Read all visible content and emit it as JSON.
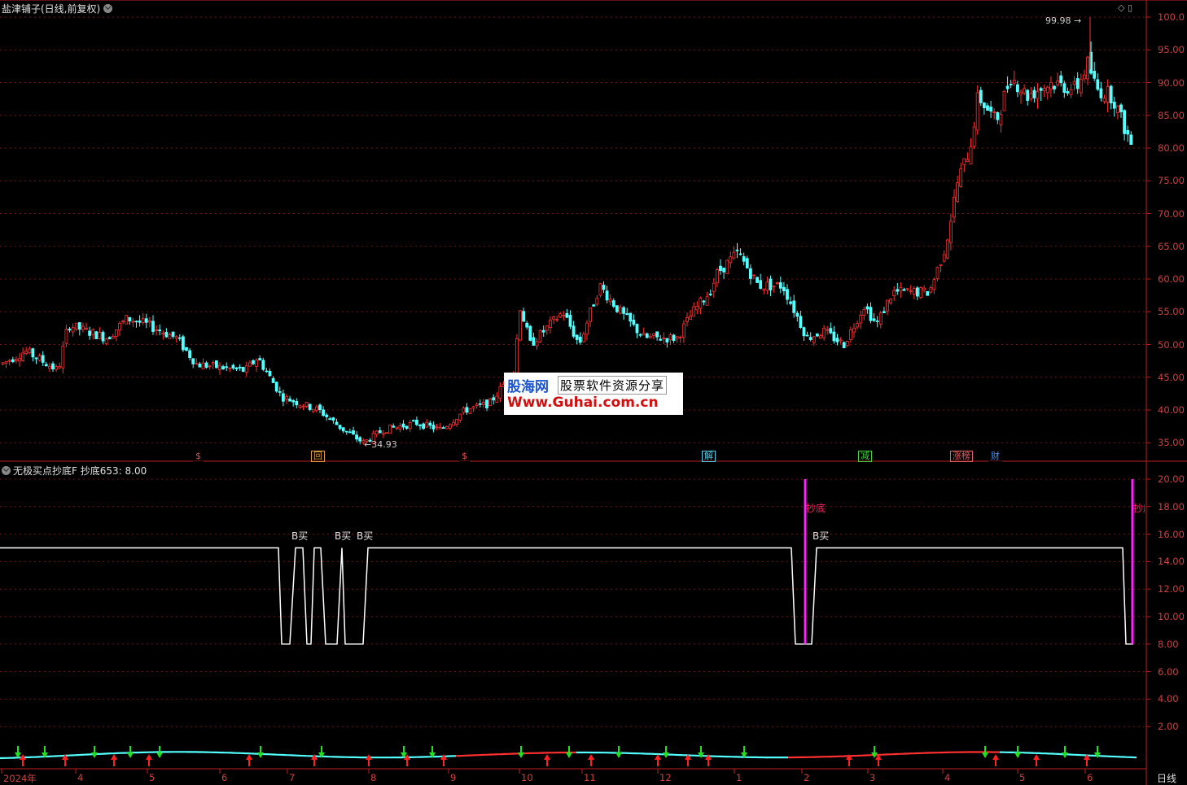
{
  "header": {
    "title": "盐津铺子(日线,前复权)",
    "indicator_title": "无极买点抄底F",
    "indicator_value": "抄底653: 8.00",
    "period_label": "日线"
  },
  "main_axis": {
    "ticks": [
      "100.0",
      "95.00",
      "90.00",
      "85.00",
      "80.00",
      "75.00",
      "70.00",
      "65.00",
      "60.00",
      "55.00",
      "50.00",
      "45.00",
      "40.00",
      "35.00"
    ],
    "high_label": "99.98",
    "low_label": "34.93"
  },
  "sub_axis": {
    "ticks": [
      "20.00",
      "18.00",
      "16.00",
      "14.00",
      "12.00",
      "10.00",
      "8.00",
      "6.00",
      "4.00",
      "2.00"
    ]
  },
  "x_axis": {
    "labels": [
      "2024年",
      "4",
      "5",
      "6",
      "7",
      "8",
      "9",
      "10",
      "11",
      "12",
      "1",
      "2",
      "3",
      "4",
      "5",
      "6"
    ]
  },
  "event_tags": [
    {
      "text": "$",
      "color": "#e05050"
    },
    {
      "text": "回",
      "color": "#e0a040"
    },
    {
      "text": "$",
      "color": "#e05050"
    },
    {
      "text": "解",
      "color": "#50c8e8"
    },
    {
      "text": "减",
      "color": "#40d040"
    },
    {
      "text": "涨榜",
      "color": "#e06060"
    },
    {
      "text": "财",
      "color": "#4090ff"
    }
  ],
  "signals": {
    "buy_label": "B买",
    "bottom_label": "抄底",
    "bottom_label_cut": "抄底"
  },
  "watermark": {
    "brand": "股海网",
    "slogan": "股票软件资源分享",
    "url": "Www.Guhai.com.cn"
  },
  "colors": {
    "up": "#ff3030",
    "down": "#54ffff",
    "grid": "#7a1010",
    "axis": "#c02020",
    "signal_line": "#ffffff",
    "bottom_bar": "#ff20ff"
  }
}
